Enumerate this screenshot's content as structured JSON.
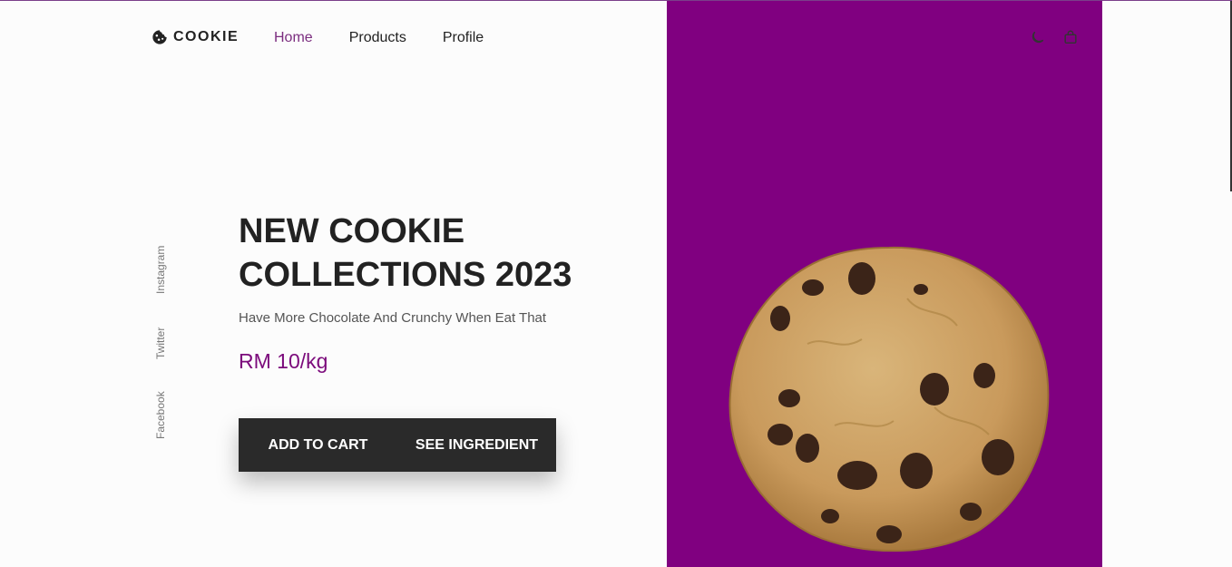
{
  "brand": {
    "name": "COOKIE",
    "icon": "cookie-icon"
  },
  "nav": {
    "items": [
      {
        "label": "Home",
        "active": true
      },
      {
        "label": "Products",
        "active": false
      },
      {
        "label": "Profile",
        "active": false
      }
    ]
  },
  "header_icons": [
    "moon-icon",
    "shopping-bag-icon"
  ],
  "social": [
    "Instagram",
    "Twitter",
    "Facebook"
  ],
  "hero": {
    "title_line1": "NEW COOKIE",
    "title_line2": "COLLECTIONS 2023",
    "subtitle": "Have More Chocolate And Crunchy When Eat That",
    "price": "RM 10/kg",
    "add_to_cart": "ADD TO CART",
    "see_ingredient": "SEE INGREDIENT"
  },
  "colors": {
    "accent": "#800080",
    "nav_active": "#7b2d7f",
    "price": "#7b0a7b",
    "button_bg": "#2a2a2a"
  }
}
